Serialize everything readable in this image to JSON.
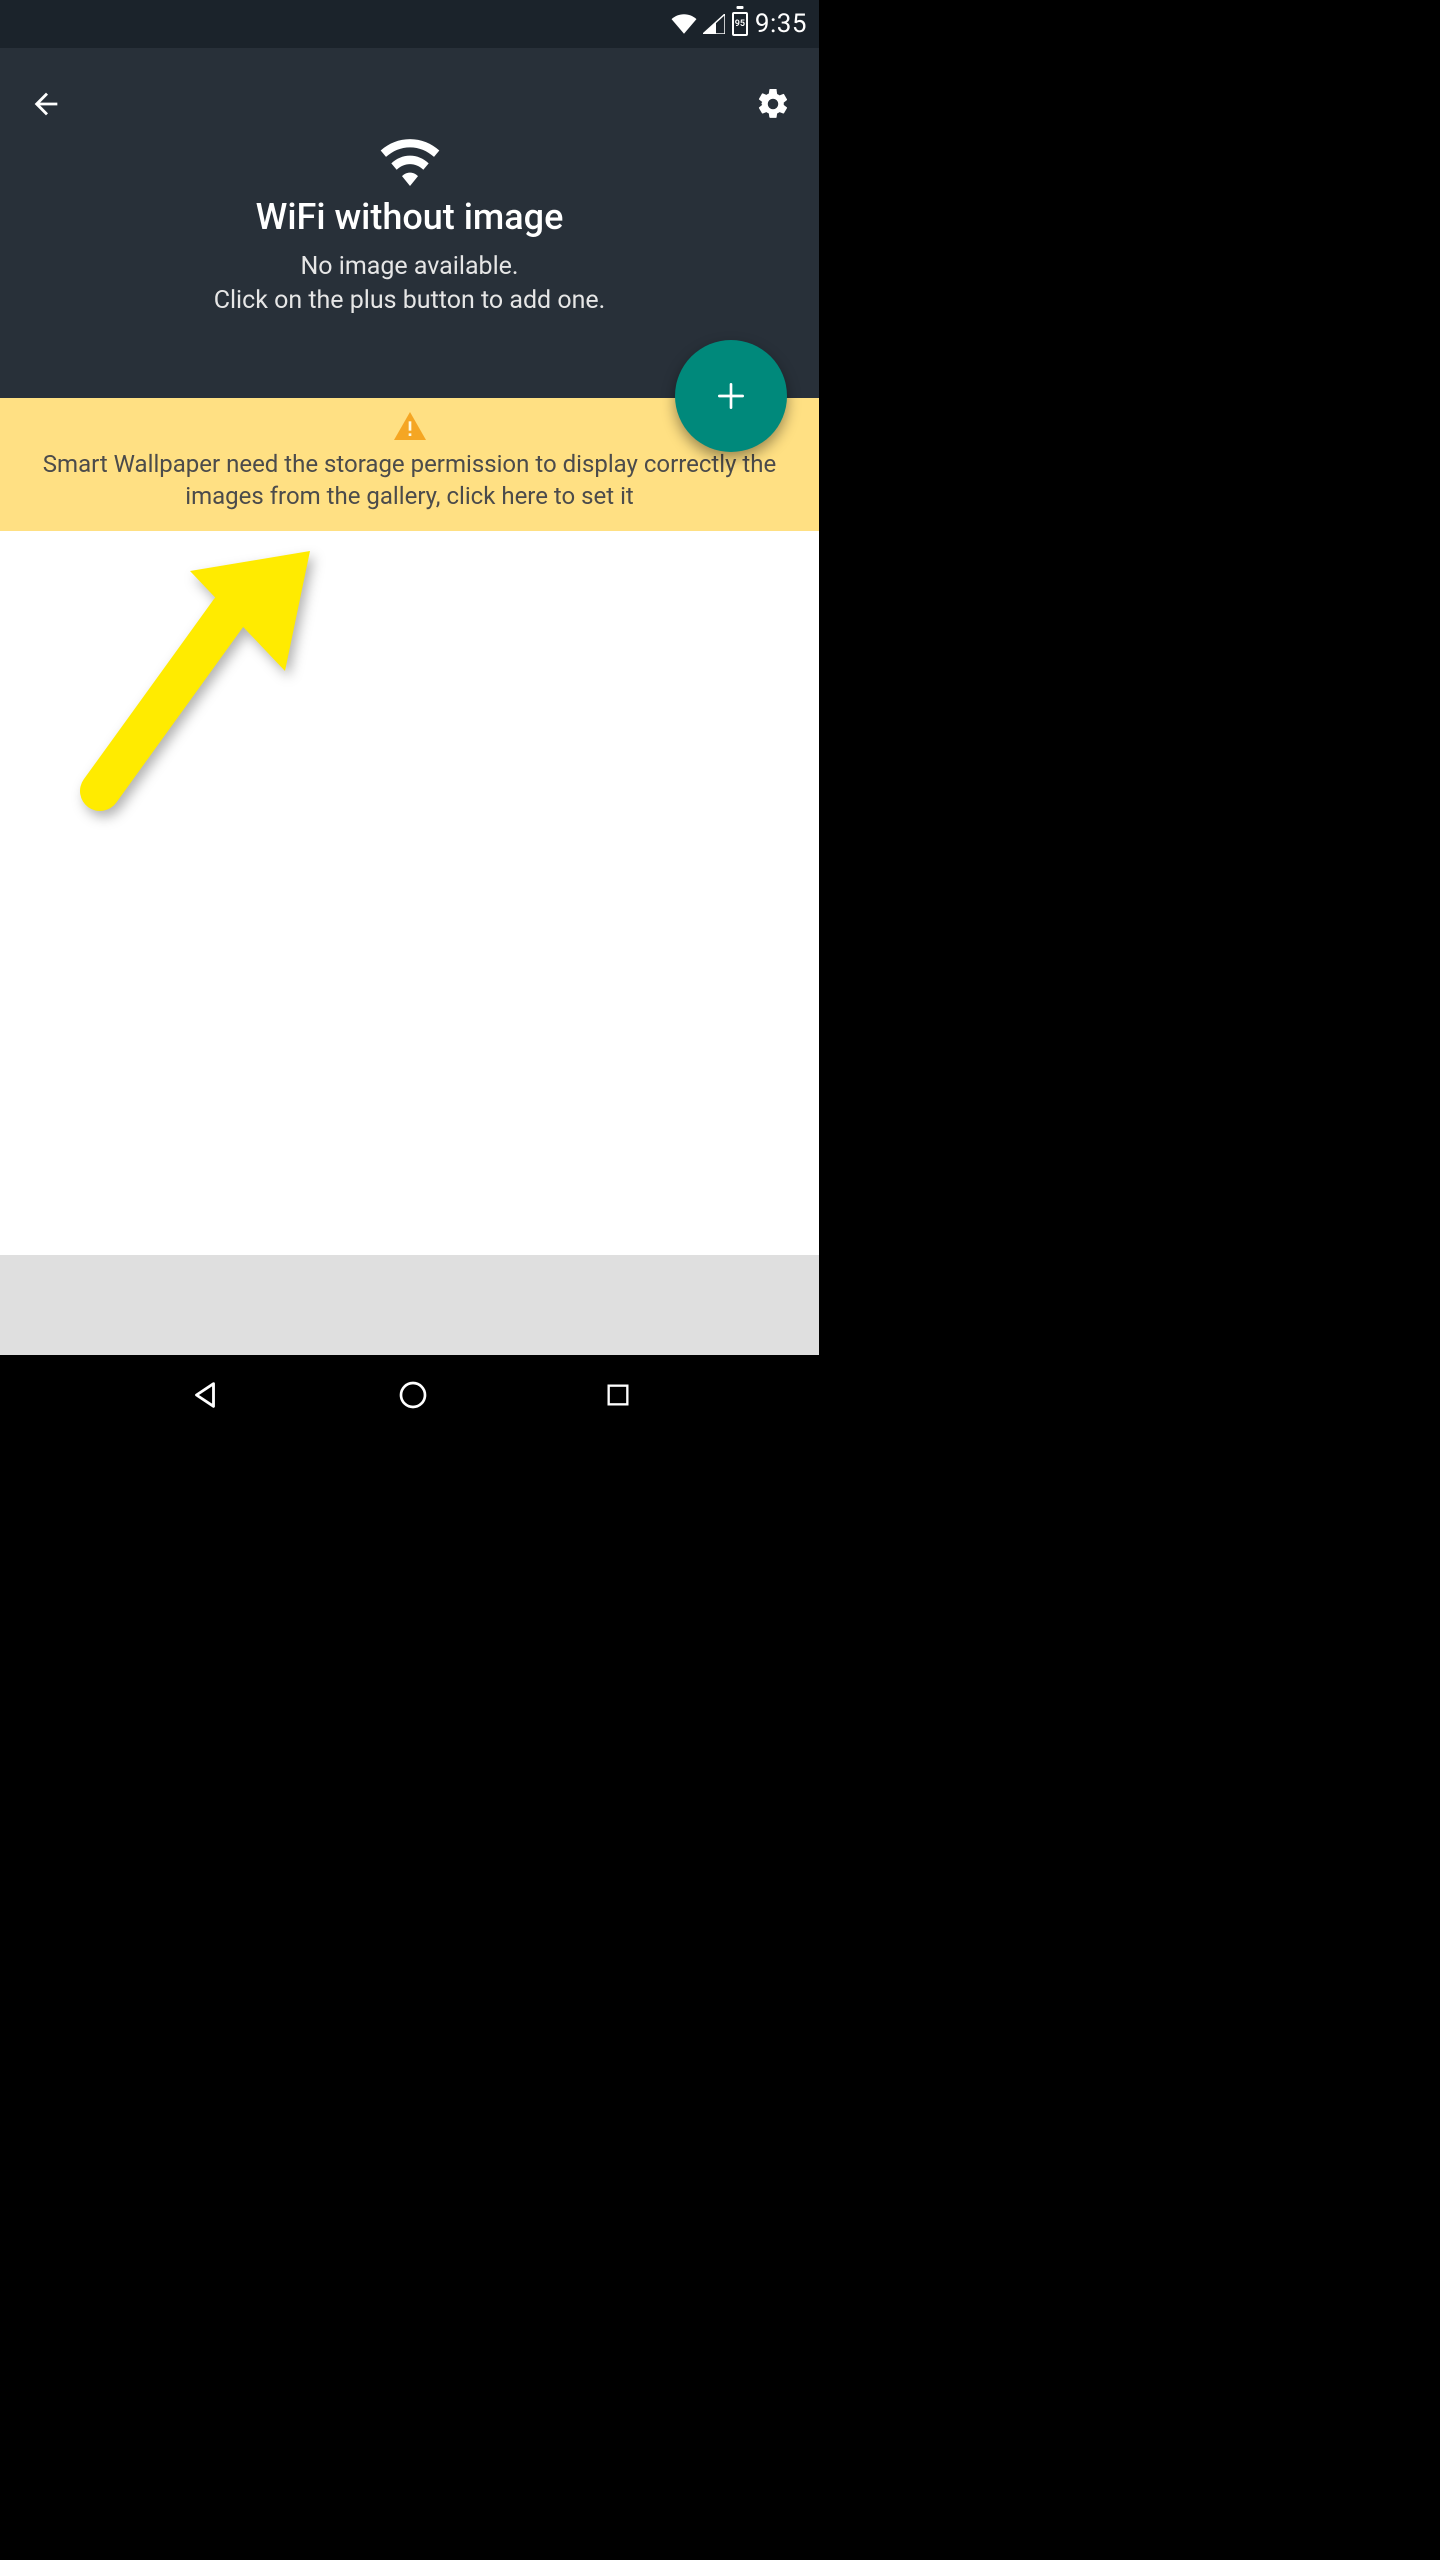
{
  "status_bar": {
    "time": "9:35",
    "battery_level": "95"
  },
  "header": {
    "title": "WiFi without image",
    "subtitle_line1": "No image available.",
    "subtitle_line2": "Click on the plus button to add one."
  },
  "banner": {
    "message": "Smart Wallpaper need the storage permission to display correctly the images from the gallery, click here to set it"
  },
  "icons": {
    "back": "back-arrow",
    "settings": "gear",
    "wifi": "wifi",
    "add": "plus",
    "warning": "warning"
  },
  "colors": {
    "header_bg": "#283039",
    "status_bg": "#1b232b",
    "banner_bg": "#ffe083",
    "fab_bg": "#00897b",
    "arrow": "#ffeb3b"
  }
}
